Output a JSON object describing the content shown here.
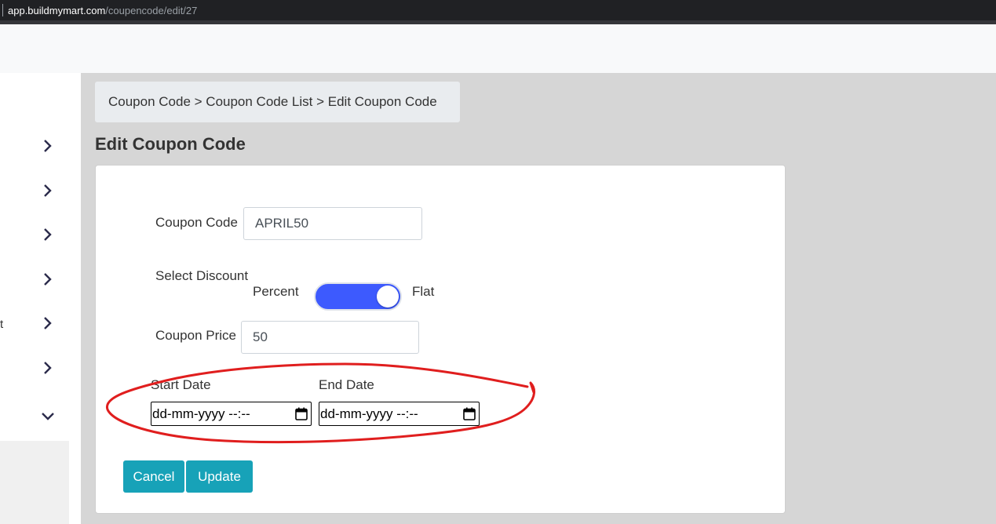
{
  "browser": {
    "url_host": "app.buildmymart.com",
    "url_path": "/coupencode/edit/27"
  },
  "sidebar": {
    "items": [
      {
        "icon": "chevron-right-icon",
        "label": ""
      },
      {
        "icon": "chevron-right-icon",
        "label": ""
      },
      {
        "icon": "chevron-right-icon",
        "label": ""
      },
      {
        "icon": "chevron-right-icon",
        "label": ""
      },
      {
        "icon": "chevron-right-icon",
        "label": "t"
      },
      {
        "icon": "chevron-right-icon",
        "label": ""
      },
      {
        "icon": "chevron-down-icon",
        "label": ""
      }
    ]
  },
  "breadcrumb": {
    "text": "Coupon Code > Coupon Code List > Edit Coupon Code"
  },
  "page": {
    "title": "Edit Coupon Code"
  },
  "form": {
    "coupon_code_label": "Coupon Code",
    "coupon_code_value": "APRIL50",
    "discount_label": "Select Discount",
    "percent_label": "Percent",
    "flat_label": "Flat",
    "discount_toggle_on": true,
    "coupon_price_label": "Coupon Price",
    "coupon_price_value": "50",
    "start_date_label": "Start Date",
    "start_date_value": "dd-mm-yyyy --:--",
    "end_date_label": "End Date",
    "end_date_value": "dd-mm-yyyy --:--",
    "cancel_label": "Cancel",
    "update_label": "Update"
  },
  "colors": {
    "toggle_accent": "#3d5afe",
    "button_bg": "#17a2b8",
    "annotation": "#e01e1e"
  }
}
